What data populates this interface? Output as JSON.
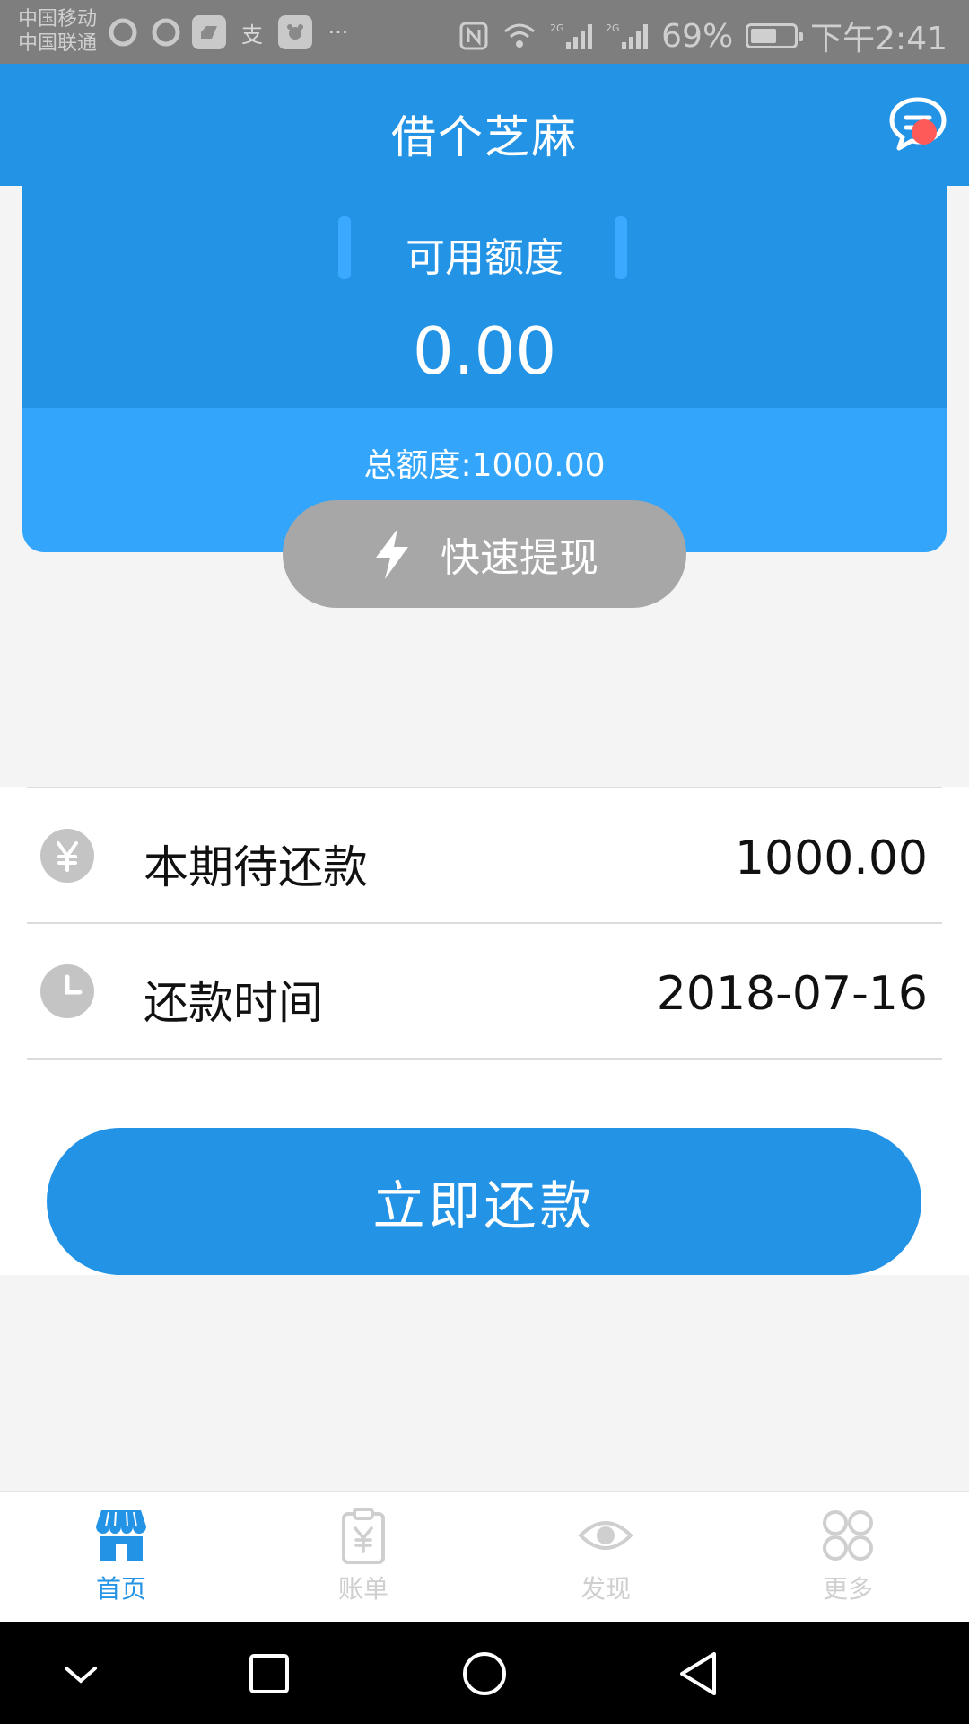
{
  "status_bar": {
    "carrier_1": "中国移动",
    "carrier_2": "中国联通",
    "battery": "69%",
    "time": "下午2:41",
    "more": "···",
    "alipay_icon": "支",
    "signal_label": "2G"
  },
  "header": {
    "title": "借个芝麻",
    "message_icon": "chat-bubble-icon"
  },
  "credit": {
    "available_label": "可用额度",
    "available_amount": "0.00",
    "total_label": "总额度:1000.00",
    "quick_withdraw_label": "快速提现"
  },
  "repayment": {
    "due_label": "本期待还款",
    "due_value": "1000.00",
    "date_label": "还款时间",
    "date_value": "2018-07-16",
    "repay_button": "立即还款"
  },
  "bottom_nav": {
    "items": [
      {
        "label": "首页",
        "icon": "store-icon",
        "active": true
      },
      {
        "label": "账单",
        "icon": "bill-icon",
        "active": false
      },
      {
        "label": "发现",
        "icon": "eye-icon",
        "active": false
      },
      {
        "label": "更多",
        "icon": "more-grid-icon",
        "active": false
      }
    ]
  },
  "colors": {
    "primary": "#2393e6",
    "card_light": "#33a6fb",
    "button_gray": "#a7a7a7",
    "badge_red": "#ff5a5a"
  }
}
